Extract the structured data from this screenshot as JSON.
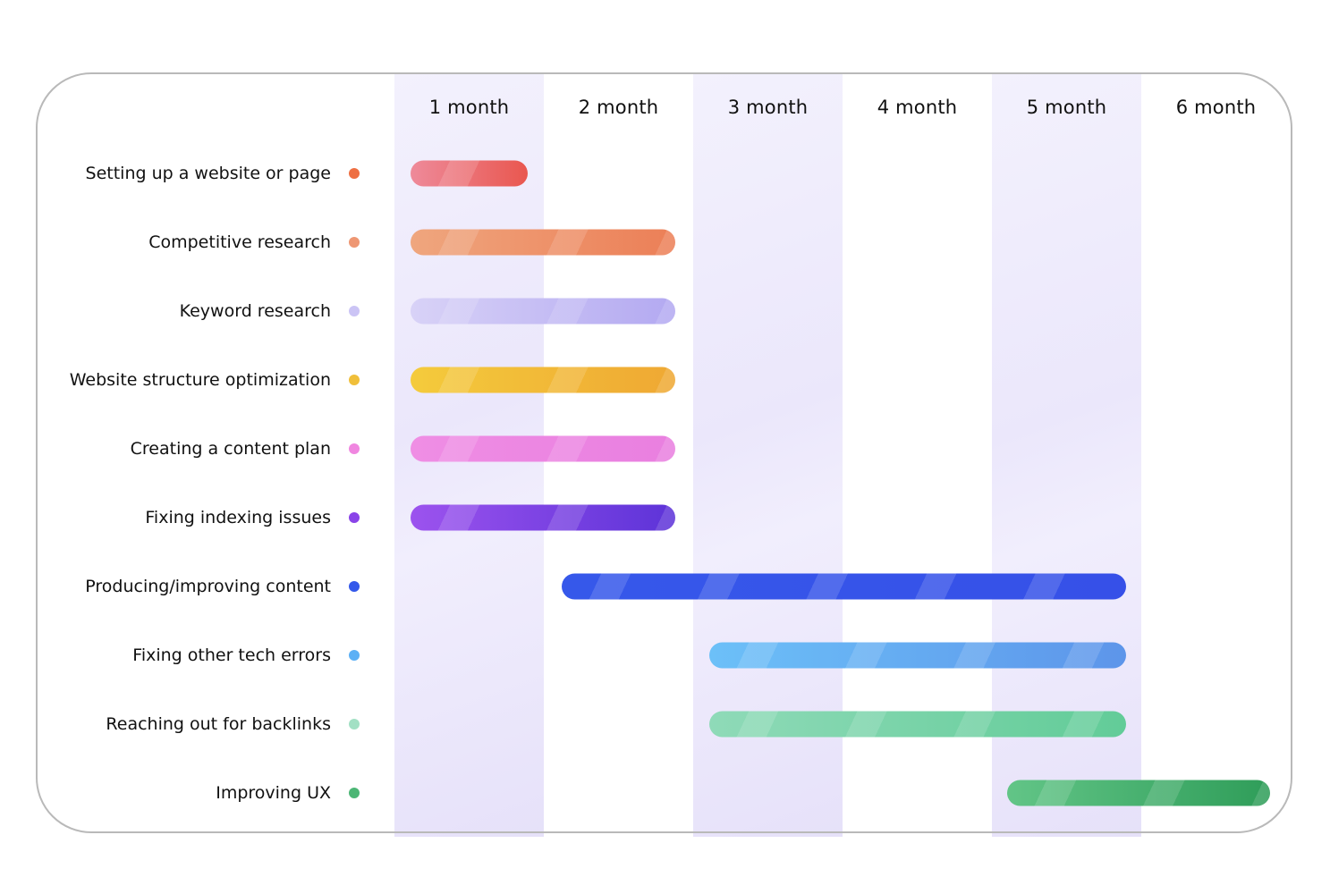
{
  "chart_data": {
    "type": "gantt",
    "title": "",
    "xlabel": "",
    "ylabel": "",
    "columns": [
      "1 month",
      "2 month",
      "3 month",
      "4 month",
      "5 month",
      "6 month"
    ],
    "shaded_columns": [
      1,
      3,
      5
    ],
    "xlim_months": [
      0,
      6
    ],
    "tasks": [
      {
        "name": "Setting up a website or page",
        "start_month": 0.11,
        "end_month": 0.89,
        "color_start": "#ee8a9a",
        "color_end": "#e9574f",
        "dot_color": "#ee6f42"
      },
      {
        "name": "Competitive research",
        "start_month": 0.11,
        "end_month": 1.88,
        "color_start": "#efa67e",
        "color_end": "#ec7f57",
        "dot_color": "#ee9773"
      },
      {
        "name": "Keyword research",
        "start_month": 0.11,
        "end_month": 1.88,
        "color_start": "#d8d2f7",
        "color_end": "#b3a9f1",
        "dot_color": "#cbc4f5"
      },
      {
        "name": "Website structure optimization",
        "start_month": 0.11,
        "end_month": 1.88,
        "color_start": "#f4cb3c",
        "color_end": "#efa833",
        "dot_color": "#f0bf3a"
      },
      {
        "name": "Creating a content plan",
        "start_month": 0.11,
        "end_month": 1.88,
        "color_start": "#ef8ee4",
        "color_end": "#e97fe0",
        "dot_color": "#f086e0"
      },
      {
        "name": "Fixing indexing issues",
        "start_month": 0.11,
        "end_month": 1.88,
        "color_start": "#9c53ee",
        "color_end": "#5d33d8",
        "dot_color": "#8a44e8"
      },
      {
        "name": "Producing/improving content",
        "start_month": 1.12,
        "end_month": 4.9,
        "color_start": "#3658ea",
        "color_end": "#3650e8",
        "dot_color": "#3458ea"
      },
      {
        "name": "Fixing other tech errors",
        "start_month": 2.11,
        "end_month": 4.9,
        "color_start": "#6cc0f8",
        "color_end": "#5d95ea",
        "dot_color": "#5cb0f5"
      },
      {
        "name": "Reaching out for backlinks",
        "start_month": 2.11,
        "end_month": 4.9,
        "color_start": "#8fdab8",
        "color_end": "#62cc98",
        "dot_color": "#a2e0c4"
      },
      {
        "name": "Improving UX",
        "start_month": 4.1,
        "end_month": 5.86,
        "color_start": "#62c587",
        "color_end": "#2f9d59",
        "dot_color": "#4cb675"
      }
    ]
  }
}
